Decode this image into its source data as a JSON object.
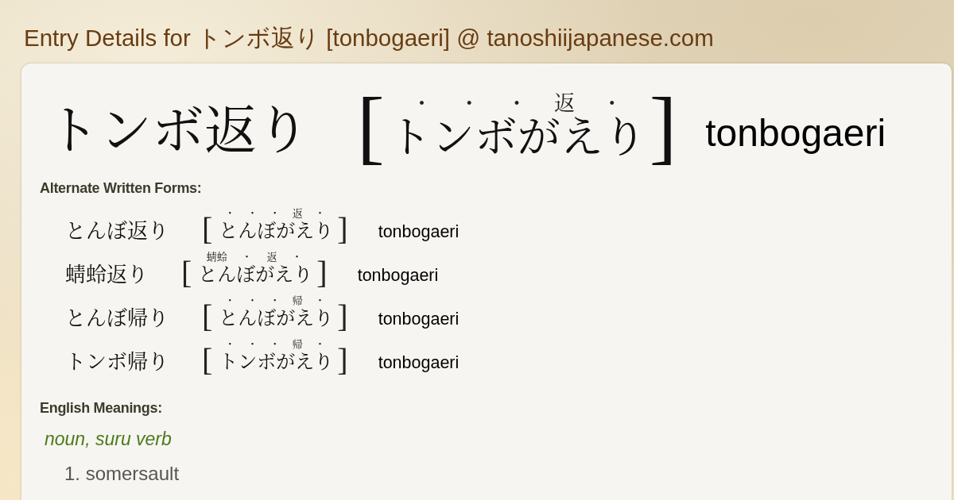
{
  "page_title": "Entry Details for トンボ返り [tonbogaeri] @ tanoshiijapanese.com",
  "entry": {
    "writing": "トンボ返り",
    "reading": {
      "open": "[",
      "ruby": [
        "・",
        "・",
        "・",
        "返",
        "・"
      ],
      "text": "トンボがえり",
      "close": "]"
    },
    "romaji": "tonbogaeri"
  },
  "alternate_forms": {
    "heading": "Alternate Written Forms:",
    "items": [
      {
        "writing": "とんぼ返り",
        "reading": {
          "open": "[",
          "ruby": [
            "・",
            "・",
            "・",
            "返",
            "・"
          ],
          "text": "とんぼがえり",
          "close": "]"
        },
        "romaji": "tonbogaeri"
      },
      {
        "writing": "蜻蛉返り",
        "reading": {
          "open": "[",
          "ruby": [
            "蜻蛉",
            "・",
            "返",
            "・"
          ],
          "text": "とんぼがえり",
          "close": "]"
        },
        "romaji": "tonbogaeri"
      },
      {
        "writing": "とんぼ帰り",
        "reading": {
          "open": "[",
          "ruby": [
            "・",
            "・",
            "・",
            "帰",
            "・"
          ],
          "text": "とんぼがえり",
          "close": "]"
        },
        "romaji": "tonbogaeri"
      },
      {
        "writing": "トンボ帰り",
        "reading": {
          "open": "[",
          "ruby": [
            "・",
            "・",
            "・",
            "帰",
            "・"
          ],
          "text": "トンボがえり",
          "close": "]"
        },
        "romaji": "tonbogaeri"
      }
    ]
  },
  "meanings": {
    "heading": "English Meanings:",
    "groups": [
      {
        "part_of_speech": "noun, suru verb",
        "senses": [
          "1. somersault"
        ]
      }
    ]
  }
}
